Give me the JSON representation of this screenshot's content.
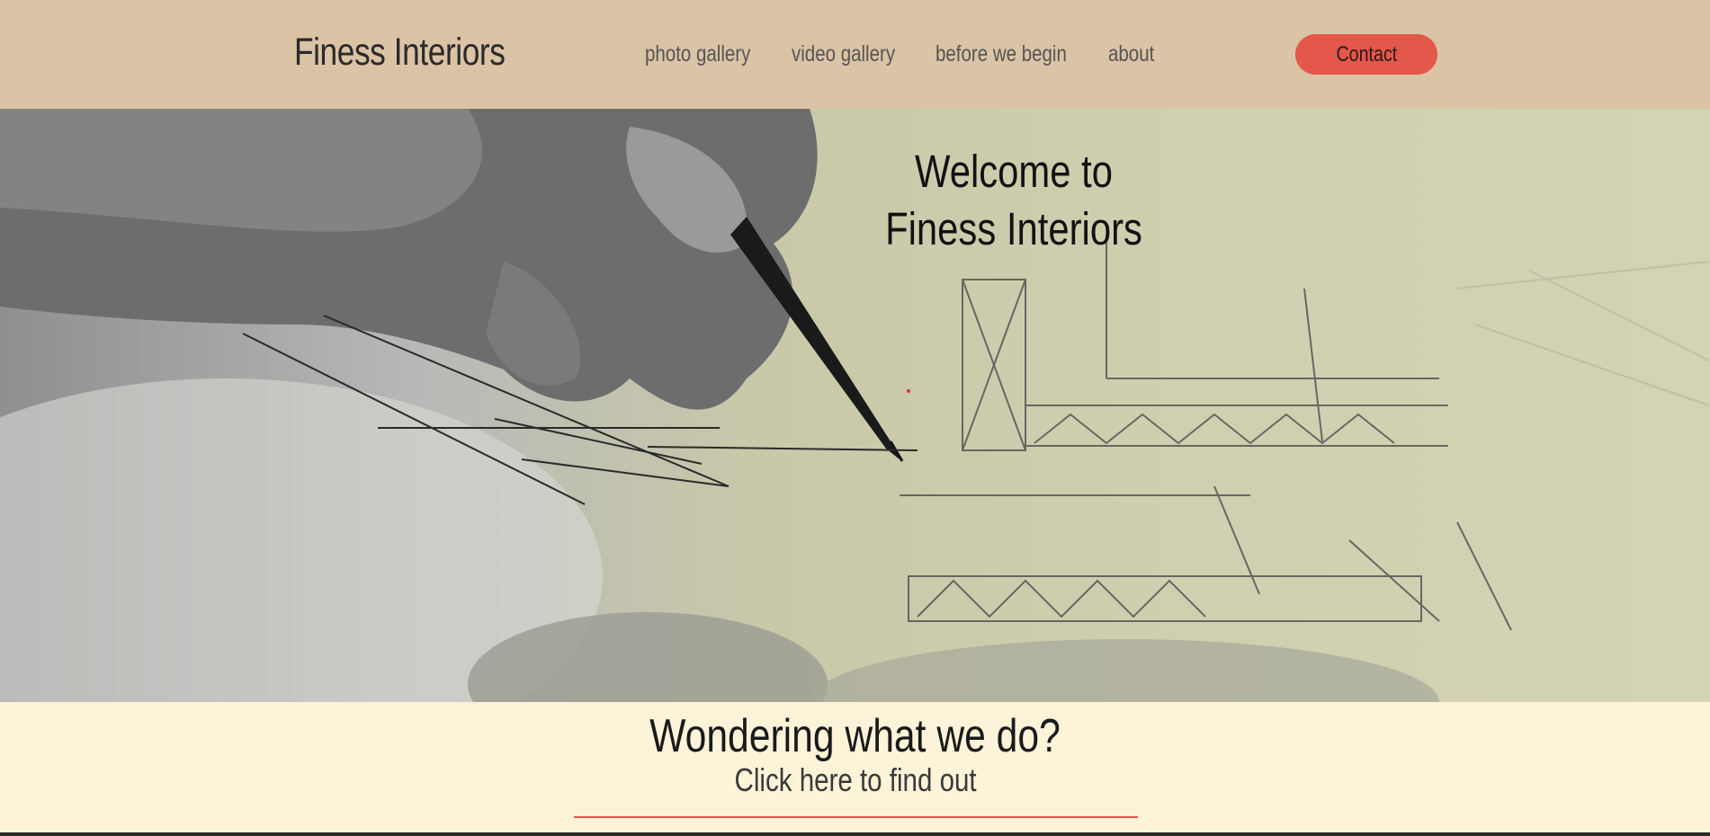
{
  "header": {
    "logo": "Finess Interiors",
    "nav": [
      "photo gallery",
      "video gallery",
      "before we begin",
      "about"
    ],
    "contact_label": "Contact"
  },
  "hero": {
    "title_line1": "Welcome to",
    "title_line2": "Finess Interiors"
  },
  "section": {
    "heading": "Wondering what we do?",
    "link_text": "Click here to find out"
  },
  "colors": {
    "header_bg": "#dbc3a5",
    "accent": "#e4574b",
    "band_bg": "#fdf3d8"
  }
}
